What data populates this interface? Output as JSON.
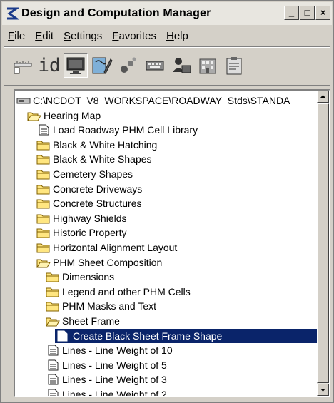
{
  "window": {
    "title": "Design and Computation Manager"
  },
  "title_buttons": [
    "_",
    "□",
    "×"
  ],
  "menu": [
    {
      "label": "File",
      "u": "F",
      "rest": "ile"
    },
    {
      "label": "Edit",
      "u": "E",
      "rest": "dit"
    },
    {
      "label": "Settings",
      "u": "S",
      "rest": "ettings"
    },
    {
      "label": "Favorites",
      "u": "F",
      "rest": "avorites"
    },
    {
      "label": "Help",
      "u": "H",
      "rest": "elp"
    }
  ],
  "toolbar": {
    "items": [
      "ruler-icon",
      "id-icon",
      "monitor-icon",
      "edit-tool-icon",
      "bubbles-icon",
      "keyboard-icon",
      "users-icon",
      "building-icon",
      "clipboard-icon"
    ],
    "id_text": "id",
    "active": "monitor-icon"
  },
  "tree": {
    "root": "C:\\NCDOT_V8_WORKSPACE\\ROADWAY_Stds\\STANDA",
    "items": [
      {
        "label": "Hearing Map",
        "type": "folder-open",
        "level": 1
      },
      {
        "label": "Load Roadway PHM Cell Library",
        "type": "doc",
        "level": 2
      },
      {
        "label": "Black & White Hatching",
        "type": "folder",
        "level": 2
      },
      {
        "label": "Black & White Shapes",
        "type": "folder",
        "level": 2
      },
      {
        "label": "Cemetery Shapes",
        "type": "folder",
        "level": 2
      },
      {
        "label": "Concrete Driveways",
        "type": "folder",
        "level": 2
      },
      {
        "label": "Concrete Structures",
        "type": "folder",
        "level": 2
      },
      {
        "label": "Highway Shields",
        "type": "folder",
        "level": 2
      },
      {
        "label": "Historic Property",
        "type": "folder",
        "level": 2
      },
      {
        "label": "Horizontal Alignment Layout",
        "type": "folder",
        "level": 2
      },
      {
        "label": "PHM Sheet Composition",
        "type": "folder-open",
        "level": 2
      },
      {
        "label": "Dimensions",
        "type": "folder",
        "level": 3
      },
      {
        "label": "Legend and other PHM Cells",
        "type": "folder",
        "level": 3
      },
      {
        "label": "PHM Masks and Text",
        "type": "folder",
        "level": 3
      },
      {
        "label": "Sheet Frame",
        "type": "folder-open",
        "level": 3
      },
      {
        "label": "Create Black Sheet Frame Shape",
        "type": "doc",
        "level": 4,
        "selected": true
      },
      {
        "label": "Lines - Line Weight of 10",
        "type": "doc",
        "level": 3
      },
      {
        "label": "Lines - Line Weight of 5",
        "type": "doc",
        "level": 3
      },
      {
        "label": "Lines - Line Weight of 3",
        "type": "doc",
        "level": 3
      },
      {
        "label": "Lines - Line Weight of 2",
        "type": "doc",
        "level": 3
      }
    ]
  },
  "colors": {
    "selection": "#0a246a",
    "folder": "#ffe680",
    "folder_edge": "#806000",
    "chrome": "#d4d0c8"
  }
}
